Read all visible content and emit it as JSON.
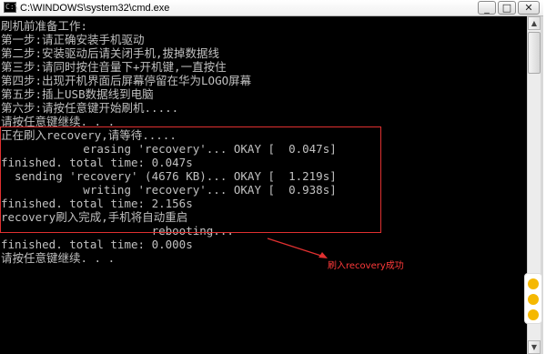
{
  "window": {
    "title": "C:\\WINDOWS\\system32\\cmd.exe",
    "icon_label": "C:\\",
    "buttons": {
      "minimize": "_",
      "maximize": "□",
      "close": "✕"
    }
  },
  "console": {
    "lines": [
      "刷机前准备工作:",
      "第一步:请正确安装手机驱动",
      "第二步:安装驱动后请关闭手机,拔掉数据线",
      "第三步:请同时按住音量下+开机键,一直按住",
      "第四步:出现开机界面后屏幕停留在华为LOGO屏幕",
      "第五步:插上USB数据线到电脑",
      "第六步:请按任意键开始刷机.....",
      "请按任意键继续. . .",
      "正在刷入recovery,请等待.....",
      "            erasing 'recovery'... OKAY [  0.047s]",
      "finished. total time: 0.047s",
      "  sending 'recovery' (4676 KB)... OKAY [  1.219s]",
      "            writing 'recovery'... OKAY [  0.938s]",
      "finished. total time: 2.156s",
      "recovery刷入完成,手机将自动重启",
      "                      rebooting...",
      "",
      "finished. total time: 0.000s",
      "请按任意键继续. . ."
    ]
  },
  "annotation": {
    "text": "刷入recovery成功",
    "color": "#ff3a3a"
  },
  "scrollbar": {
    "up_icon": "▲",
    "down_icon": "▼"
  }
}
